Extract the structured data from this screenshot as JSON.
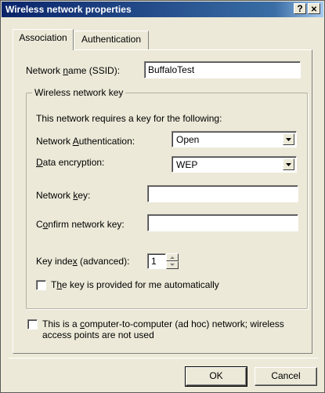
{
  "window": {
    "title": "Wireless network properties",
    "help_button": "?",
    "close_button": "✕"
  },
  "tabs": [
    {
      "label": "Association",
      "active": true
    },
    {
      "label": "Authentication",
      "active": false
    }
  ],
  "network_name": {
    "label": "Network name (SSID):",
    "value": "BuffaloTest"
  },
  "wireless_key_group": {
    "title": "Wireless network key",
    "description": "This network requires a key for the following:",
    "authentication": {
      "label": "Network Authentication:",
      "value": "Open"
    },
    "encryption": {
      "label": "Data encryption:",
      "value": "WEP"
    },
    "network_key": {
      "label": "Network key:",
      "value": ""
    },
    "confirm_key": {
      "label": "Confirm network key:",
      "value": ""
    },
    "key_index": {
      "label": "Key index (advanced):",
      "value": "1"
    },
    "auto_key_checkbox": {
      "label": "The key is provided for me automatically",
      "checked": false
    }
  },
  "adhoc_checkbox": {
    "label_line1": "This is a computer-to-computer (ad hoc) network; wireless",
    "label_line2": "access points are not used",
    "checked": false
  },
  "buttons": {
    "ok": "OK",
    "cancel": "Cancel"
  },
  "colors": {
    "dialog_bg": "#ece9d8",
    "titlebar_start": "#0a246a",
    "titlebar_end": "#a6caf0"
  },
  "icons": {
    "dropdown": "chevron-down-icon",
    "spin_up": "arrow-up-icon",
    "spin_down": "arrow-down-icon"
  }
}
